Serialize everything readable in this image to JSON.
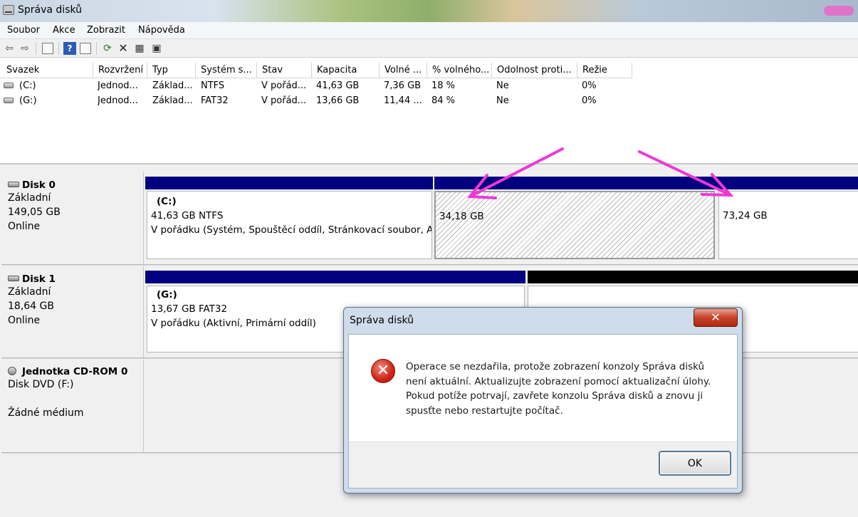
{
  "window": {
    "title": "Správa disků"
  },
  "menu": [
    "Soubor",
    "Akce",
    "Zobrazit",
    "Nápověda"
  ],
  "toolbar": {
    "icons": [
      "back-icon",
      "forward-icon",
      "view-icon",
      "help-icon",
      "properties-icon",
      "refresh-icon",
      "delete-icon",
      "settings-icon",
      "drive-icon"
    ]
  },
  "volume_table": {
    "columns": [
      "Svazek",
      "Rozvržení",
      "Typ",
      "Systém s...",
      "Stav",
      "Kapacita",
      "Volné ...",
      "% volného...",
      "Odolnost proti...",
      "Režie"
    ],
    "rows": [
      [
        "(C:)",
        "Jednod...",
        "Základ...",
        "NTFS",
        "V pořád...",
        "41,63 GB",
        "7,36 GB",
        "18 %",
        "Ne",
        "0%"
      ],
      [
        "(G:)",
        "Jednod...",
        "Základ...",
        "FAT32",
        "V pořád...",
        "13,66 GB",
        "11,44 ...",
        "84 %",
        "Ne",
        "0%"
      ]
    ]
  },
  "disks": [
    {
      "name": "Disk 0",
      "type": "Základní",
      "size": "149,05 GB",
      "status": "Online",
      "partitions": [
        {
          "label": "(C:)",
          "line1": "41,63 GB NTFS",
          "line2": "V pořádku (Systém, Spouštěcí oddíl, Stránkovací soubor, Ak"
        },
        {
          "label": "",
          "line1": "34,18 GB",
          "line2": ""
        },
        {
          "label": "",
          "line1": "73,24 GB",
          "line2": ""
        }
      ]
    },
    {
      "name": "Disk 1",
      "type": "Základní",
      "size": "18,64 GB",
      "status": "Online",
      "partitions": [
        {
          "label": "(G:)",
          "line1": "13,67 GB FAT32",
          "line2": "V pořádku (Aktivní, Primární oddíl)"
        }
      ]
    }
  ],
  "cdrom": {
    "name": "Jednotka CD-ROM 0",
    "type": "Disk DVD (F:)",
    "status": "Žádné médium"
  },
  "dialog": {
    "title": "Správa disků",
    "message": "Operace se nezdařila, protože zobrazení konzoly Správa disků není aktuální. Aktualizujte zobrazení pomocí aktualizační úlohy. Pokud potíže potrvají, zavřete konzolu Správa disků a znovu ji spusťte nebo restartujte počítač.",
    "ok_label": "OK",
    "close_glyph": "✕",
    "error_glyph": "✕"
  },
  "colors": {
    "primary_partition_bar": "#000080",
    "unallocated_bar": "#000000",
    "annotation_arrow": "#ee38d6"
  }
}
